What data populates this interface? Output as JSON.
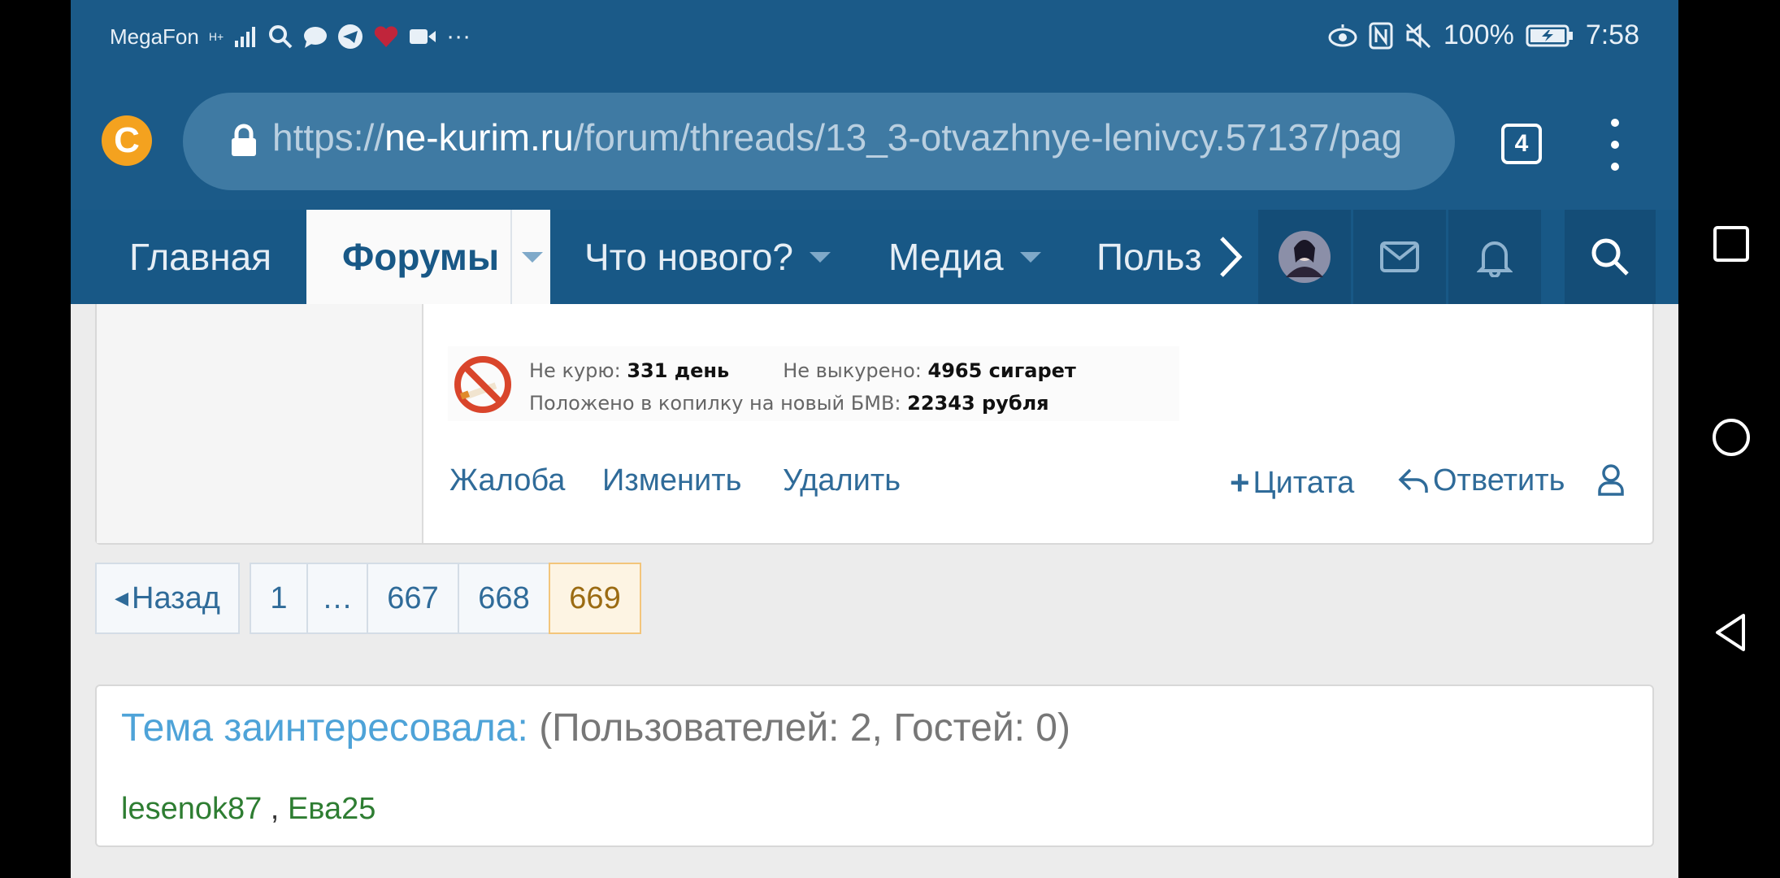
{
  "status_bar": {
    "carrier": "MegaFon",
    "network": "H+",
    "battery": "100%",
    "time": "7:58"
  },
  "browser": {
    "url_scheme": "https://",
    "url_host": "ne-kurim.ru",
    "url_path": "/forum/threads/13_3-otvazhnye-lenivcy.57137/pag",
    "tab_count": "4"
  },
  "nav": {
    "home": "Главная",
    "forums": "Форумы",
    "whats_new": "Что нового?",
    "media": "Медиа",
    "users": "Польз"
  },
  "signature": {
    "not_smoking_label": "Не курю:",
    "not_smoking_value": "331 день",
    "not_smoked_label": "Не выкурено:",
    "not_smoked_value": "4965 сигарет",
    "saved_label": "Положено в копилку на новый БМВ:",
    "saved_value": "22343 рубля"
  },
  "post_actions": {
    "report": "Жалоба",
    "edit": "Изменить",
    "delete": "Удалить",
    "quote": "Цитата",
    "reply": "Ответить"
  },
  "pagination": {
    "prev": "Назад",
    "pages": [
      "1",
      "…",
      "667",
      "668",
      "669"
    ],
    "current": "669"
  },
  "interested": {
    "title": "Тема заинтересовала:",
    "counts": "(Пользователей: 2, Гостей: 0)",
    "users": [
      "lesenok87",
      "Ева25"
    ],
    "separator": " , "
  }
}
